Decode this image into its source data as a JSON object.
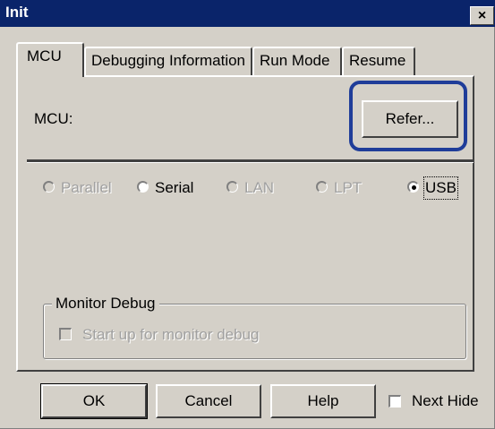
{
  "window": {
    "title": "Init",
    "close_glyph": "×"
  },
  "tabs": [
    {
      "label": "MCU",
      "active": true
    },
    {
      "label": "Debugging Information",
      "active": false
    },
    {
      "label": "Run Mode",
      "active": false
    },
    {
      "label": "Resume",
      "active": false
    }
  ],
  "mcu": {
    "label": "MCU:",
    "refer_label": "Refer..."
  },
  "connection": {
    "options": [
      {
        "label": "Parallel",
        "enabled": false,
        "selected": false
      },
      {
        "label": "Serial",
        "enabled": true,
        "selected": false
      },
      {
        "label": "LAN",
        "enabled": false,
        "selected": false
      },
      {
        "label": "LPT",
        "enabled": false,
        "selected": false
      },
      {
        "label": "USB",
        "enabled": true,
        "selected": true
      }
    ]
  },
  "monitor_debug": {
    "legend": "Monitor Debug",
    "checkbox_label": "Start up for monitor debug",
    "checked": false,
    "enabled": false
  },
  "buttons": {
    "ok": "OK",
    "cancel": "Cancel",
    "help": "Help"
  },
  "next_hide": {
    "label": "Next Hide",
    "checked": false
  },
  "colors": {
    "title_bar": "#0a246a",
    "highlight": "#1f3d99",
    "face": "#d4d0c8"
  }
}
